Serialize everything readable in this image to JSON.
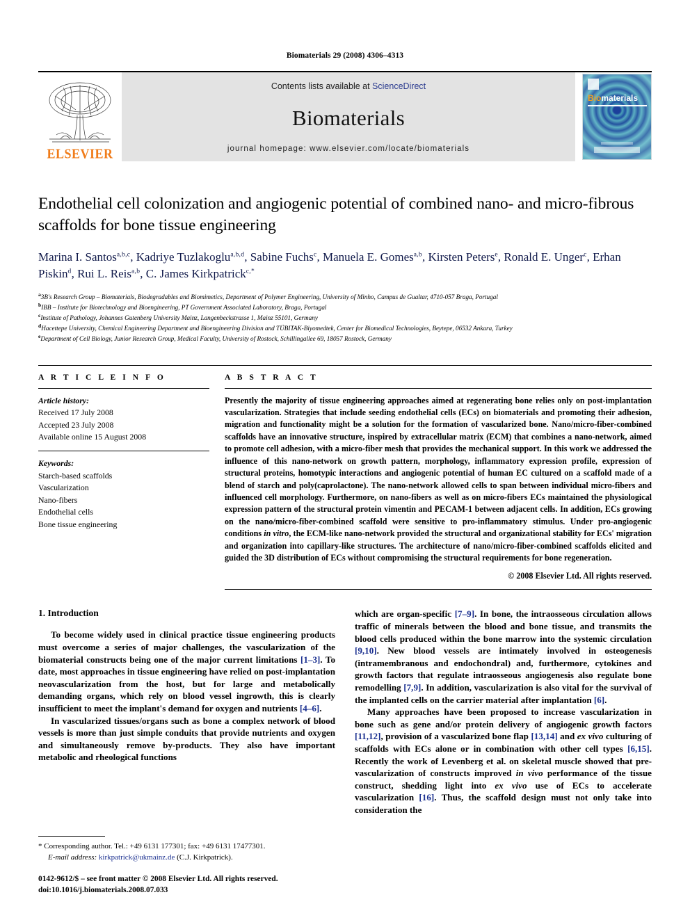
{
  "running_head": "Biomaterials 29 (2008) 4306–4313",
  "masthead": {
    "publisher_name": "ELSEVIER",
    "contents_prefix": "Contents lists available at ",
    "contents_link": "ScienceDirect",
    "journal_name": "Biomaterials",
    "homepage": "journal homepage: www.elsevier.com/locate/biomaterials",
    "cover_title_bio": "Bio",
    "cover_title_rest": "materials",
    "link_color": "#2b3b8f",
    "elsevier_orange": "#f07c1a"
  },
  "article": {
    "title": "Endothelial cell colonization and angiogenic potential of combined nano- and micro-fibrous scaffolds for bone tissue engineering",
    "authors": [
      {
        "name": "Marina I. Santos",
        "sup": "a,b,c"
      },
      {
        "name": "Kadriye Tuzlakoglu",
        "sup": "a,b,d"
      },
      {
        "name": "Sabine Fuchs",
        "sup": "c"
      },
      {
        "name": "Manuela E. Gomes",
        "sup": "a,b"
      },
      {
        "name": "Kirsten Peters",
        "sup": "e"
      },
      {
        "name": "Ronald E. Unger",
        "sup": "c"
      },
      {
        "name": "Erhan Piskin",
        "sup": "d"
      },
      {
        "name": "Rui L. Reis",
        "sup": "a,b"
      },
      {
        "name": "C. James Kirkpatrick",
        "sup": "c,*"
      }
    ],
    "affiliations": [
      {
        "label": "a",
        "text": "3B's Research Group – Biomaterials, Biodegradables and Biomimetics, Department of Polymer Engineering, University of Minho, Campus de Gualtar, 4710-057 Braga, Portugal"
      },
      {
        "label": "b",
        "text": "IBB – Institute for Biotechnology and Bioengineering, PT Government Associated Laboratory, Braga, Portugal"
      },
      {
        "label": "c",
        "text": "Institute of Pathology, Johannes Gutenberg University Mainz, Langenbeckstrasse 1, Mainz 55101, Germany"
      },
      {
        "label": "d",
        "text": "Hacettepe University, Chemical Engineering Department and Bioengineering Division and TÜBITAK-Biyomedtek, Center for Biomedical Technologies, Beytepe, 06532 Ankara, Turkey"
      },
      {
        "label": "e",
        "text": "Department of Cell Biology, Junior Research Group, Medical Faculty, University of Rostock, Schillingallee 69, 18057 Rostock, Germany"
      }
    ]
  },
  "article_info": {
    "heading": "A R T I C L E   I N F O",
    "history_label": "Article history:",
    "history": [
      "Received 17 July 2008",
      "Accepted 23 July 2008",
      "Available online 15 August 2008"
    ],
    "keywords_label": "Keywords:",
    "keywords": [
      "Starch-based scaffolds",
      "Vascularization",
      "Nano-fibers",
      "Endothelial cells",
      "Bone tissue engineering"
    ]
  },
  "abstract": {
    "heading": "A B S T R A C T",
    "paragraph_1": "Presently the majority of tissue engineering approaches aimed at regenerating bone relies only on post-implantation vascularization. Strategies that include seeding endothelial cells (ECs) on biomaterials and promoting their adhesion, migration and functionality might be a solution for the formation of vascularized bone. Nano/micro-fiber-combined scaffolds have an innovative structure, inspired by extracellular matrix (ECM) that combines a nano-network, aimed to promote cell adhesion, with a micro-fiber mesh that provides the mechanical support. In this work we addressed the influence of this nano-network on growth pattern, morphology, inflammatory expression profile, expression of structural proteins, homotypic interactions and angiogenic potential of human EC cultured on a scaffold made of a blend of starch and poly(caprolactone). The nano-network allowed cells to span between individual micro-fibers and influenced cell morphology. Furthermore, on nano-fibers as well as on micro-fibers ECs maintained the physiological expression pattern of the structural protein vimentin and PECAM-1 between adjacent cells. In addition, ECs growing on the nano/micro-fiber-combined scaffold were sensitive to pro-inflammatory stimulus. Under pro-angiogenic conditions ",
    "italic_1": "in vitro",
    "paragraph_1b": ", the ECM-like nano-network provided the structural and organizational stability for ECs' migration and organization into capillary-like structures. The architecture of nano/micro-fiber-combined scaffolds elicited and guided the 3D distribution of ECs without compromising the structural requirements for bone regeneration.",
    "copyright": "© 2008 Elsevier Ltd. All rights reserved."
  },
  "introduction": {
    "section_number_title": "1. Introduction",
    "left_paragraphs": [
      {
        "parts": [
          {
            "t": "To become widely used in clinical practice tissue engineering products must overcome a series of major challenges, the vascularization of the biomaterial constructs being one of the major current limitations "
          },
          {
            "t": "[1–3]",
            "k": "ref"
          },
          {
            "t": ". To date, most approaches in tissue engineering have relied on post-implantation neovascularization from the host, but for large and metabolically demanding organs, which rely on blood vessel ingrowth, this is clearly insufficient to meet the implant's demand for oxygen and nutrients "
          },
          {
            "t": "[4–6]",
            "k": "ref"
          },
          {
            "t": "."
          }
        ]
      },
      {
        "parts": [
          {
            "t": "In vascularized tissues/organs such as bone a complex network of blood vessels is more than just simple conduits that provide nutrients and oxygen and simultaneously remove by-products. They also have important metabolic and rheological functions"
          }
        ]
      }
    ],
    "right_paragraphs": [
      {
        "parts": [
          {
            "t": "which are organ-specific "
          },
          {
            "t": "[7–9]",
            "k": "ref"
          },
          {
            "t": ". In bone, the intraosseous circulation allows traffic of minerals between the blood and bone tissue, and transmits the blood cells produced within the bone marrow into the systemic circulation "
          },
          {
            "t": "[9,10]",
            "k": "ref"
          },
          {
            "t": ". New blood vessels are intimately involved in osteogenesis (intramembranous and endochondral) and, furthermore, cytokines and growth factors that regulate intraosseous angiogenesis also regulate bone remodelling "
          },
          {
            "t": "[7,9]",
            "k": "ref"
          },
          {
            "t": ". In addition, vascularization is also vital for the survival of the implanted cells on the carrier material after implantation "
          },
          {
            "t": "[6]",
            "k": "ref"
          },
          {
            "t": "."
          }
        ]
      },
      {
        "parts": [
          {
            "t": "Many approaches have been proposed to increase vascularization in bone such as gene and/or protein delivery of angiogenic growth factors "
          },
          {
            "t": "[11,12]",
            "k": "ref"
          },
          {
            "t": ", provision of a vascularized bone flap "
          },
          {
            "t": "[13,14]",
            "k": "ref"
          },
          {
            "t": " and "
          },
          {
            "t": "ex vivo",
            "k": "i"
          },
          {
            "t": " culturing of scaffolds with ECs alone or in combination with other cell types "
          },
          {
            "t": "[6,15]",
            "k": "ref"
          },
          {
            "t": ". Recently the work of Levenberg et al. on skeletal muscle showed that pre-vascularization of constructs improved "
          },
          {
            "t": "in vivo",
            "k": "i"
          },
          {
            "t": " performance of the tissue construct, shedding light into "
          },
          {
            "t": "ex vivo",
            "k": "i"
          },
          {
            "t": " use of ECs to accelerate vascularization "
          },
          {
            "t": "[16]",
            "k": "ref"
          },
          {
            "t": ". Thus, the scaffold design must not only take into consideration the"
          }
        ]
      }
    ]
  },
  "footnote": {
    "marker": "*",
    "corresponding": "Corresponding author. Tel.: +49 6131 177301; fax: +49 6131 17477301.",
    "email_label": "E-mail address:",
    "email": "kirkpatrick@ukmainz.de",
    "email_suffix": "(C.J. Kirkpatrick)."
  },
  "footer": {
    "issn_line": "0142-9612/$ – see front matter © 2008 Elsevier Ltd. All rights reserved.",
    "doi_line": "doi:10.1016/j.biomaterials.2008.07.033"
  }
}
